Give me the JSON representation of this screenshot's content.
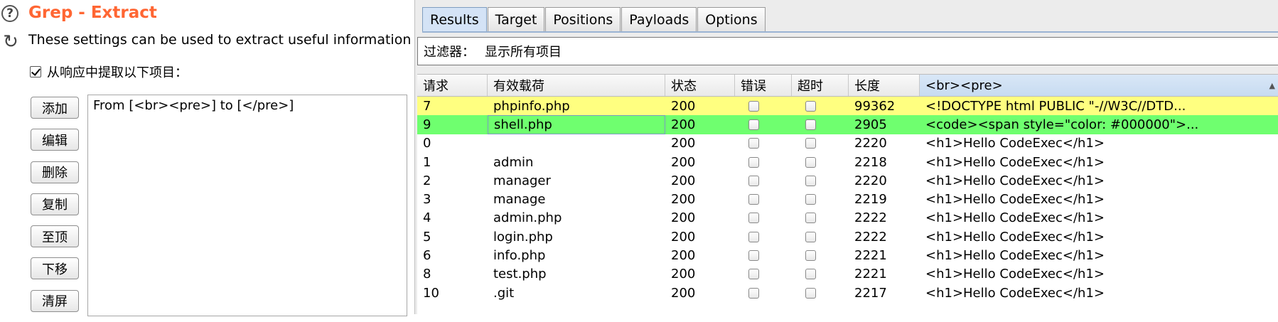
{
  "left": {
    "title": "Grep - Extract",
    "description": "These settings can be used to extract useful information fr",
    "extract_checkbox_label": "从响应中提取以下项目：",
    "extract_checked": true,
    "buttons": [
      "添加",
      "编辑",
      "删除",
      "复制",
      "至顶",
      "下移",
      "清屏"
    ],
    "rules": [
      "From [<br><pre>] to [</pre>]"
    ]
  },
  "tabs": [
    {
      "label": "Results",
      "active": true
    },
    {
      "label": "Target",
      "active": false
    },
    {
      "label": "Positions",
      "active": false
    },
    {
      "label": "Payloads",
      "active": false
    },
    {
      "label": "Options",
      "active": false
    }
  ],
  "filter": {
    "label": "过滤器：",
    "value": "显示所有项目"
  },
  "table": {
    "columns": [
      "请求",
      "有效载荷",
      "状态",
      "错误",
      "超时",
      "长度",
      "<br><pre>"
    ],
    "sorted_column": "<br><pre>",
    "rows": [
      {
        "req": "7",
        "payload": "phpinfo.php",
        "status": "200",
        "error": false,
        "timeout": false,
        "length": "99362",
        "extract": "<!DOCTYPE html PUBLIC \"-//W3C//DTD...",
        "highlight": "yellow"
      },
      {
        "req": "9",
        "payload": "shell.php",
        "status": "200",
        "error": false,
        "timeout": false,
        "length": "2905",
        "extract": "<code><span style=\"color: #000000\">...",
        "highlight": "green"
      },
      {
        "req": "0",
        "payload": "",
        "status": "200",
        "error": false,
        "timeout": false,
        "length": "2220",
        "extract": "<h1>Hello CodeExec</h1>",
        "highlight": ""
      },
      {
        "req": "1",
        "payload": "admin",
        "status": "200",
        "error": false,
        "timeout": false,
        "length": "2218",
        "extract": "<h1>Hello CodeExec</h1>",
        "highlight": ""
      },
      {
        "req": "2",
        "payload": "manager",
        "status": "200",
        "error": false,
        "timeout": false,
        "length": "2220",
        "extract": "<h1>Hello CodeExec</h1>",
        "highlight": ""
      },
      {
        "req": "3",
        "payload": "manage",
        "status": "200",
        "error": false,
        "timeout": false,
        "length": "2219",
        "extract": "<h1>Hello CodeExec</h1>",
        "highlight": ""
      },
      {
        "req": "4",
        "payload": "admin.php",
        "status": "200",
        "error": false,
        "timeout": false,
        "length": "2222",
        "extract": "<h1>Hello CodeExec</h1>",
        "highlight": ""
      },
      {
        "req": "5",
        "payload": "login.php",
        "status": "200",
        "error": false,
        "timeout": false,
        "length": "2222",
        "extract": "<h1>Hello CodeExec</h1>",
        "highlight": ""
      },
      {
        "req": "6",
        "payload": "info.php",
        "status": "200",
        "error": false,
        "timeout": false,
        "length": "2221",
        "extract": "<h1>Hello CodeExec</h1>",
        "highlight": ""
      },
      {
        "req": "8",
        "payload": "test.php",
        "status": "200",
        "error": false,
        "timeout": false,
        "length": "2221",
        "extract": "<h1>Hello CodeExec</h1>",
        "highlight": ""
      },
      {
        "req": "10",
        "payload": ".git",
        "status": "200",
        "error": false,
        "timeout": false,
        "length": "2217",
        "extract": "<h1>Hello CodeExec</h1>",
        "highlight": ""
      }
    ]
  },
  "colors": {
    "title_accent": "#ff6633",
    "row_yellow": "#ffff80",
    "row_green": "#6fff6f"
  },
  "icons": {
    "help": "help-circle-icon",
    "refresh": "refresh-icon",
    "sort": "sort-ascending-icon"
  }
}
